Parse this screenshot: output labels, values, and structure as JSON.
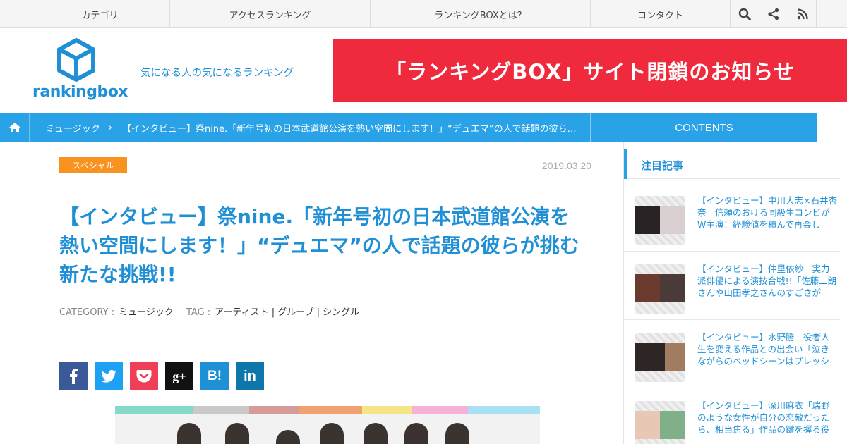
{
  "nav": {
    "items": [
      "カテゴリ",
      "アクセスランキング",
      "ランキングBOXとは？",
      "コンタクト"
    ],
    "icons": [
      "search-icon",
      "share-icon",
      "rss-icon"
    ]
  },
  "header": {
    "logo_text": "rankingbox",
    "tagline": "気になる人の気になるランキング",
    "banner_text": "「ランキングBOX」サイト閉鎖のお知らせ"
  },
  "breadcrumb": {
    "category": "ミュージック",
    "separator": "›",
    "current": "【インタビュー】祭nine.「新年号初の日本武道館公演を熱い空間にします！」“デュエマ”の人で話題の彼らが挑む新たな挑戦!!",
    "contents_label": "CONTENTS"
  },
  "article": {
    "badge": "スペシャル",
    "date": "2019.03.20",
    "title": "【インタビュー】祭nine.「新年号初の日本武道館公演を熱い空間にします！」“デュエマ”の人で話題の彼らが挑む新たな挑戦!!",
    "category_key": "CATEGORY :",
    "category_value": "ミュージック",
    "tag_key": "TAG :",
    "tags": "アーティスト | グループ | シングル",
    "share_buttons": [
      {
        "name": "facebook",
        "glyph": "f",
        "color": "#3b5998"
      },
      {
        "name": "twitter",
        "glyph": "t",
        "color": "#1da1f2"
      },
      {
        "name": "pocket",
        "glyph": "p",
        "color": "#ef3f56"
      },
      {
        "name": "google-plus",
        "glyph": "g+",
        "color": "#111111"
      },
      {
        "name": "hatena",
        "glyph": "B!",
        "color": "#1f8fd6"
      },
      {
        "name": "linkedin",
        "glyph": "in",
        "color": "#0e76a8"
      }
    ]
  },
  "sidebar": {
    "heading": "注目記事",
    "items": [
      {
        "title": "【インタビュー】中川大志×石井杏奈　信頼のおける同級生コンビがW主演！経験値を積んで再会し"
      },
      {
        "title": "【インタビュー】仲里依紗　実力派俳優による演技合戦!!「佐藤二朗さんや山田孝之さんのすごさが"
      },
      {
        "title": "【インタビュー】水野勝　役者人生を変える作品との出会い「泣きながらのベッドシーンはプレッシ"
      },
      {
        "title": "【インタビュー】深川麻衣「瑞野のような女性が自分の恋敵だったら、相当焦る」作品の鍵を握る役"
      }
    ]
  },
  "colors": {
    "accent": "#29a2e8",
    "title_blue": "#1f8fd6",
    "banner_red": "#ef2a3d",
    "badge_orange": "#f7931e"
  }
}
